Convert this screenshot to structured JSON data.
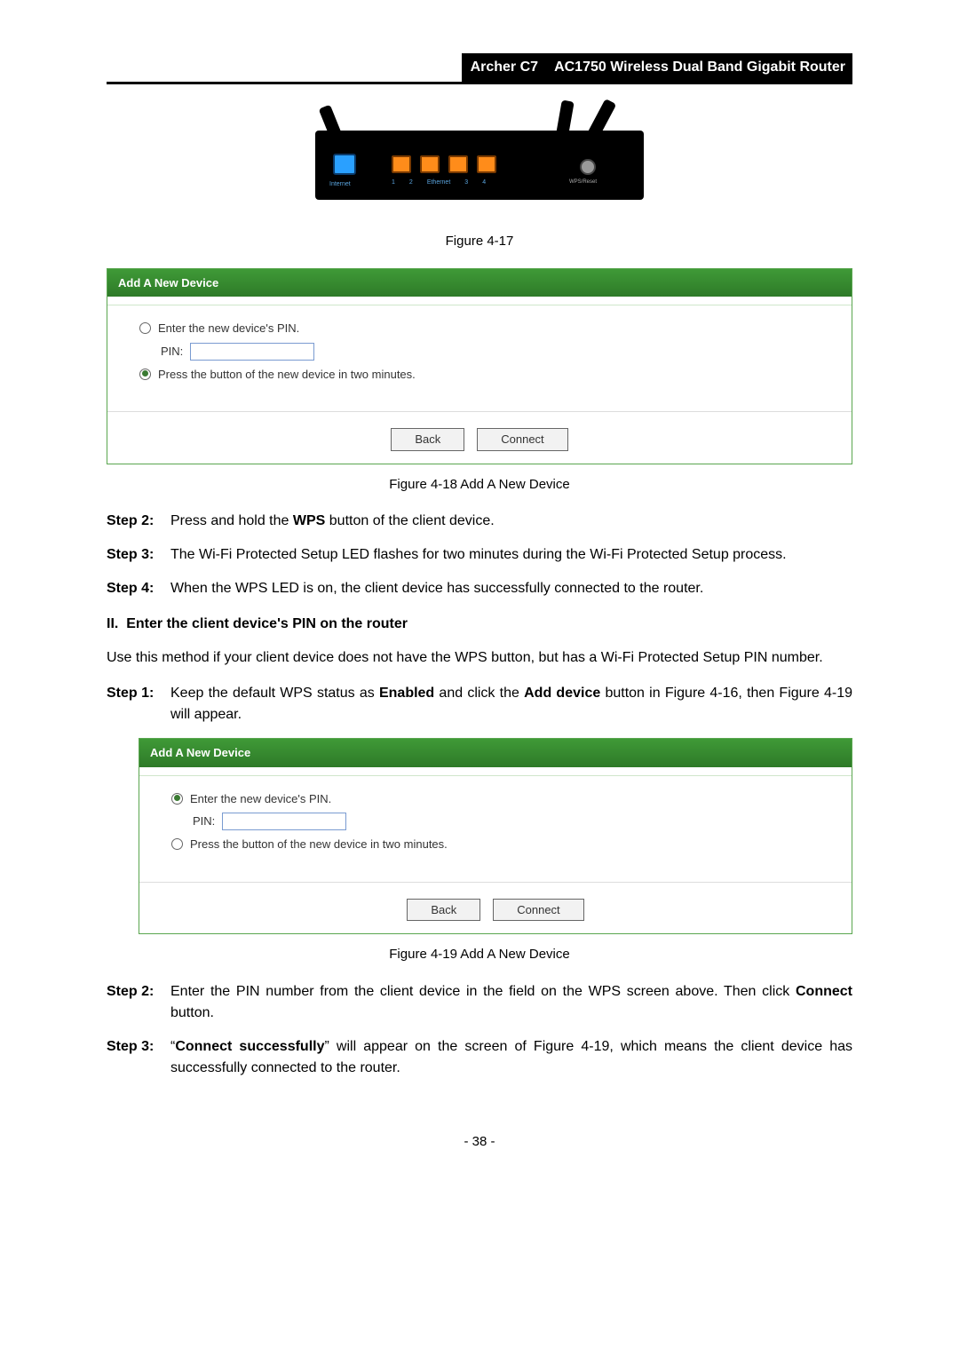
{
  "header": {
    "model": "Archer C7",
    "title": "AC1750 Wireless Dual Band Gigabit Router"
  },
  "router_labels": {
    "internet": "Internet",
    "eth1": "1",
    "eth2": "2",
    "ethernet": "Ethernet",
    "eth3": "3",
    "eth4": "4",
    "wps": "WPS/Reset"
  },
  "fig417": "Figure 4-17",
  "dialog1": {
    "heading": "Add A New Device",
    "opt_pin": "Enter the new device's PIN.",
    "pin_label": "PIN:",
    "opt_press": "Press the button of the new device in two minutes.",
    "back": "Back",
    "connect": "Connect"
  },
  "fig418": "Figure 4-18 Add A New Device",
  "step2": {
    "label": "Step 2:",
    "pre": "Press and hold the ",
    "bold": "WPS",
    "post": " button of the client device."
  },
  "step3": {
    "label": "Step 3:",
    "text": "The Wi-Fi Protected Setup LED flashes for two minutes during the Wi-Fi Protected Setup process."
  },
  "step4": {
    "label": "Step 4:",
    "text": "When the WPS LED is on, the client device has successfully connected to the router."
  },
  "section2": {
    "num": "II.",
    "title": "Enter the client device's PIN on the router"
  },
  "para2": "Use this method if your client device does not have the WPS button, but has a Wi-Fi Protected Setup PIN number.",
  "step1b": {
    "label": "Step 1:",
    "t1": "Keep the default WPS status as ",
    "b1": "Enabled",
    "t2": " and click the ",
    "b2": "Add device",
    "t3": " button in Figure 4-16, then Figure 4-19 will appear."
  },
  "dialog2": {
    "heading": "Add A New Device",
    "opt_pin": "Enter the new device's PIN.",
    "pin_label": "PIN:",
    "opt_press": "Press the button of the new device in two minutes.",
    "back": "Back",
    "connect": "Connect"
  },
  "fig419": "Figure 4-19 Add A New Device",
  "step2b": {
    "label": "Step 2:",
    "t1": "Enter the PIN number from the client device in the field on the WPS screen above. Then click ",
    "b1": "Connect",
    "t2": " button."
  },
  "step3b": {
    "label": "Step 3:",
    "t1": "“",
    "b1": "Connect successfully",
    "t2": "” will appear on the screen of Figure 4-19, which means the client device has successfully connected to the router."
  },
  "pagenum": "- 38 -"
}
